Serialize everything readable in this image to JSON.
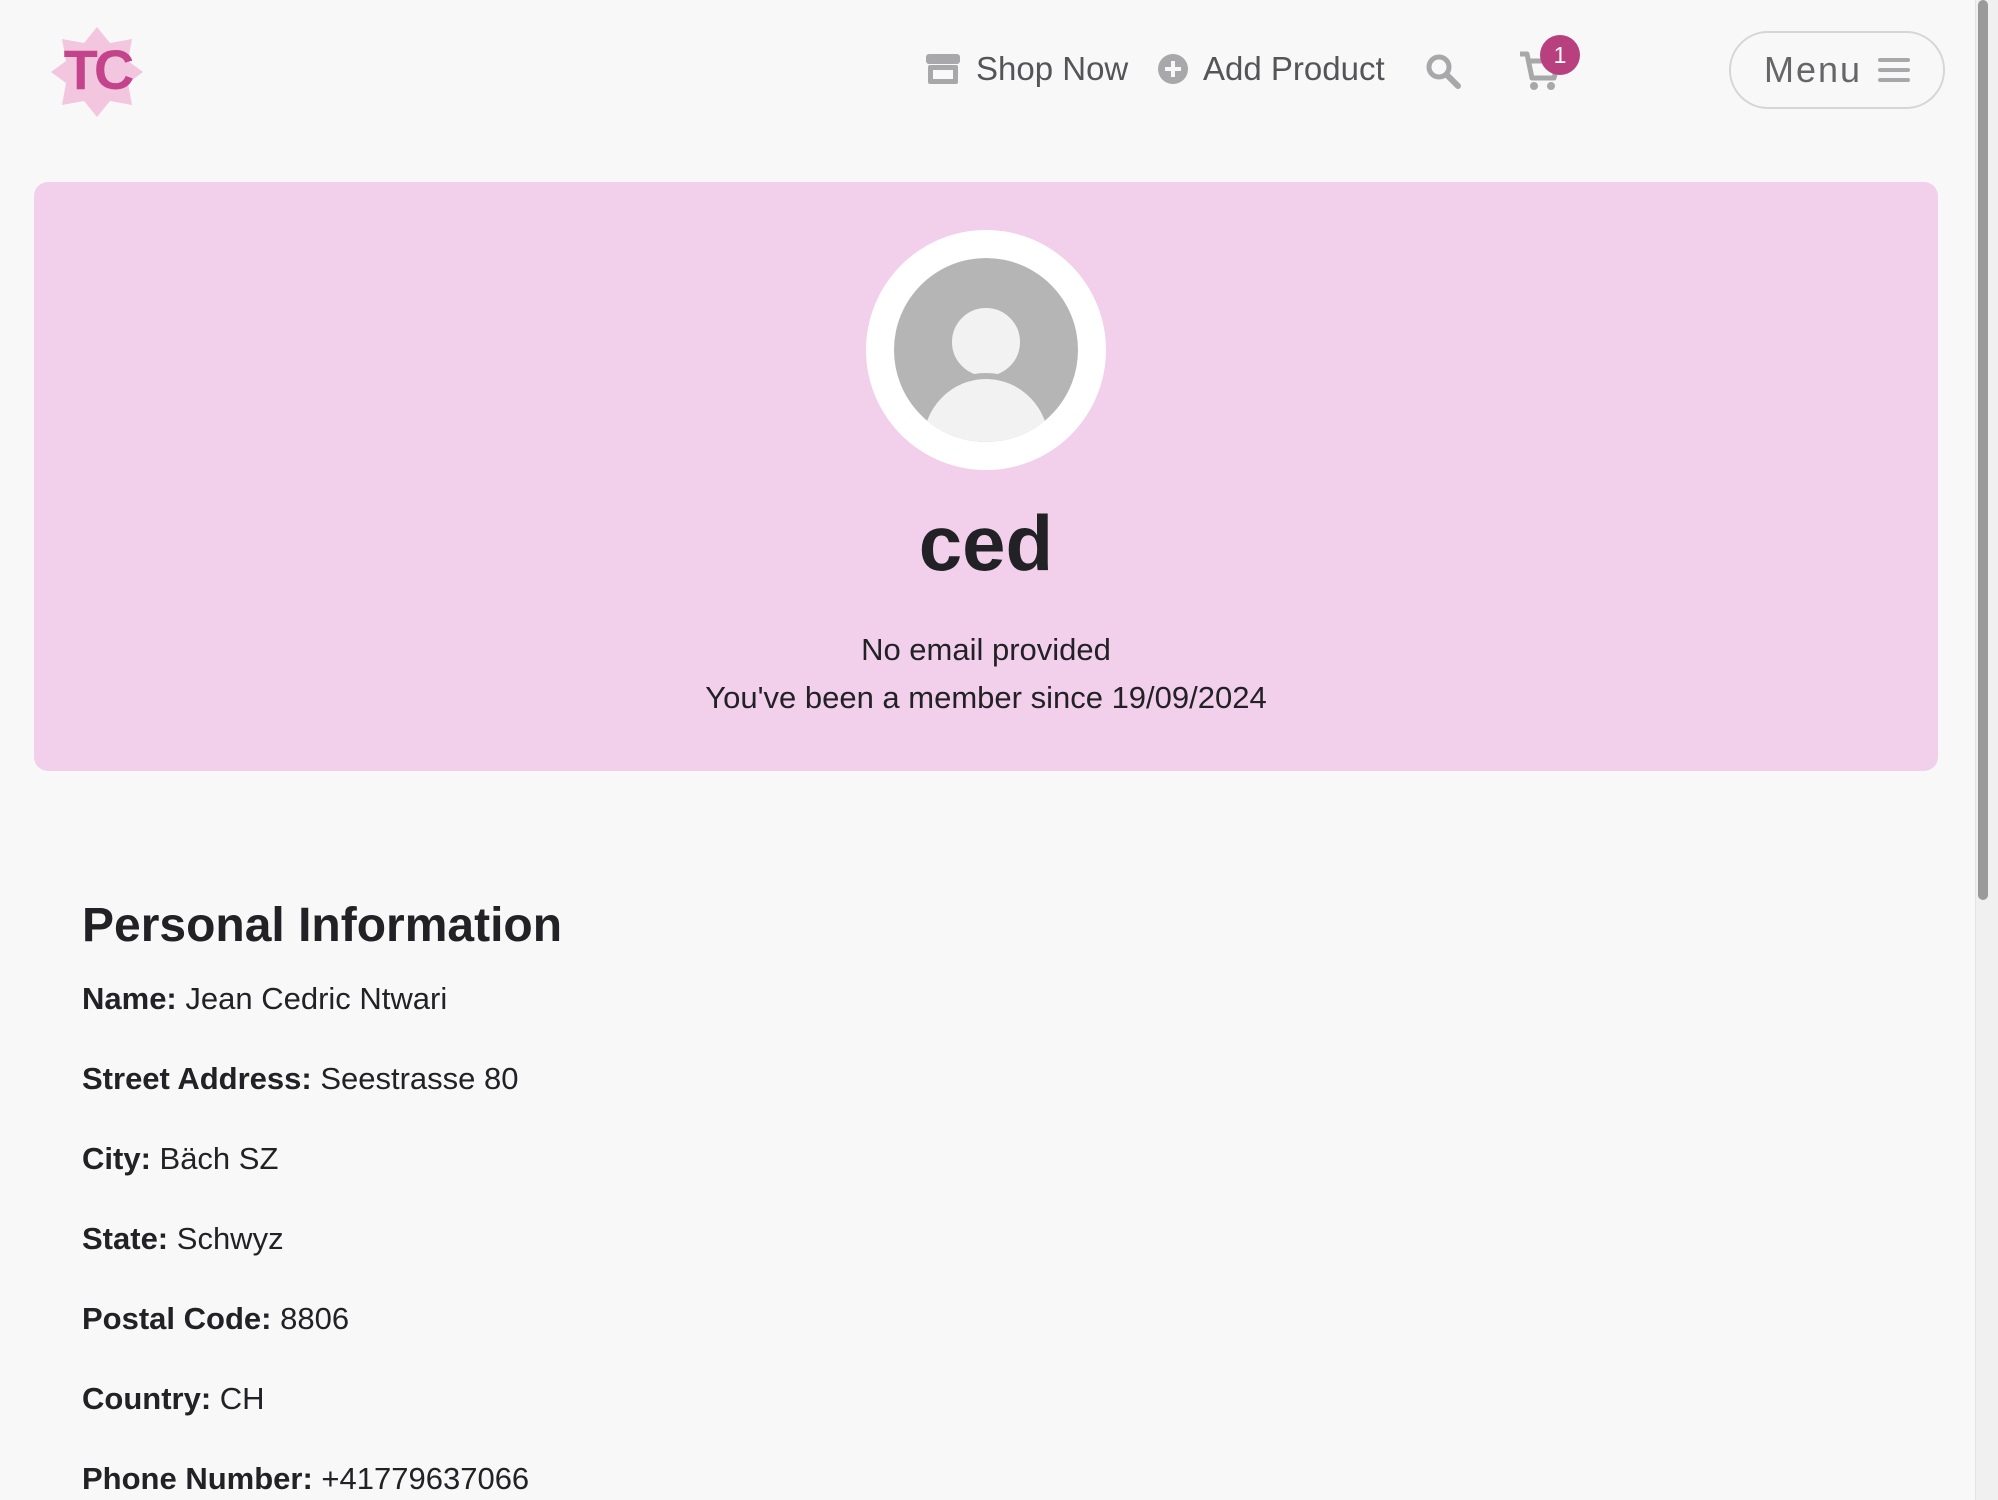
{
  "brand": {
    "logo_text": "TC",
    "primary_color": "#b9407f",
    "banner_color": "#f2d0eb"
  },
  "nav": {
    "shop_label": "Shop Now",
    "shop_icon": "store-icon",
    "add_label": "Add Product",
    "add_icon": "plus-circle-icon",
    "search_icon": "search-icon",
    "cart_icon": "cart-icon",
    "cart_count": "1",
    "menu_label": "Menu",
    "menu_icon": "hamburger-icon"
  },
  "profile": {
    "avatar_icon": "user-avatar-icon",
    "username": "ced",
    "email": "No email provided",
    "member_since": "You've been a member since 19/09/2024"
  },
  "personal_info": {
    "title": "Personal Information",
    "fields": [
      {
        "label": "Name:",
        "value": "Jean Cedric Ntwari"
      },
      {
        "label": "Street Address:",
        "value": "Seestrasse 80"
      },
      {
        "label": "City:",
        "value": "Bäch SZ"
      },
      {
        "label": "State:",
        "value": "Schwyz"
      },
      {
        "label": "Postal Code:",
        "value": "8806"
      },
      {
        "label": "Country:",
        "value": "CH"
      },
      {
        "label": "Phone Number:",
        "value": "+41779637066"
      }
    ]
  }
}
